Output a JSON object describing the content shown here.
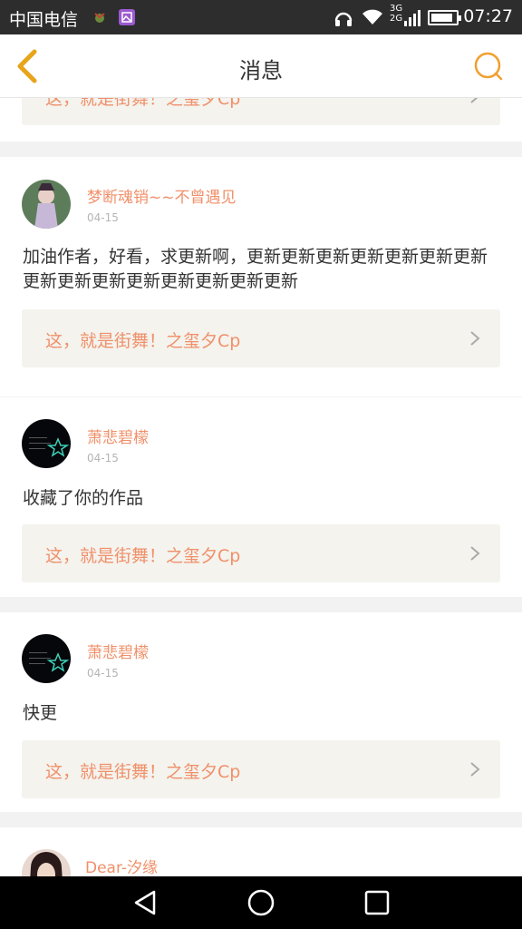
{
  "status_bar": {
    "carrier": "中国电信",
    "time": "07:27",
    "network_3g": "3G",
    "network_2g": "2G",
    "battery_level": 0.9
  },
  "header": {
    "title": "消息",
    "back_icon": "chevron-left-icon",
    "search_icon": "search-icon",
    "accent_color": "#f0a030"
  },
  "messages": [
    {
      "work_title": "这，就是街舞！之玺夕Cp"
    },
    {
      "username": "梦断魂销~~不曾遇见",
      "date": "04-15",
      "text": "加油作者，好看，求更新啊，更新更新更新更新更新更新更新更新更新更新更新更新更新更新更新",
      "work_title": "这，就是街舞！之玺夕Cp"
    },
    {
      "username": "萧悲碧檬",
      "date": "04-15",
      "text": "收藏了你的作品",
      "work_title": "这，就是街舞！之玺夕Cp"
    },
    {
      "username": "萧悲碧檬",
      "date": "04-15",
      "text": "快更",
      "work_title": "这，就是街舞！之玺夕Cp"
    },
    {
      "username": "Dear-汐缘"
    }
  ],
  "colors": {
    "username": "#f0906a",
    "link_bg": "#f4f3ee",
    "date": "#b5b5b5"
  }
}
